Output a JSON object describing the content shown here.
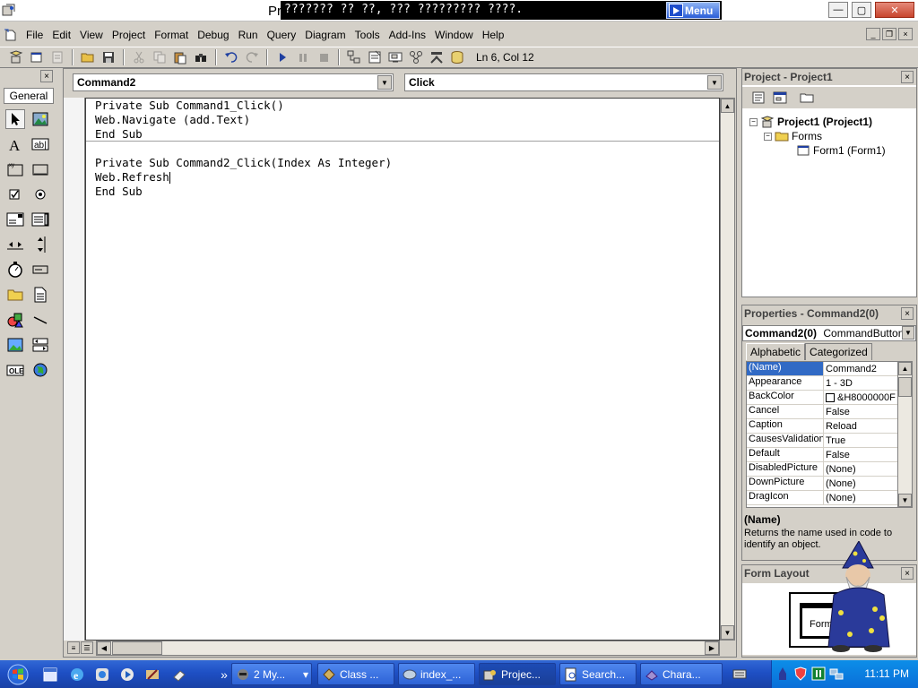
{
  "window": {
    "title_partial": "Pr",
    "overlay_text": "??????? ?? ??, ??? ????????? ????.",
    "overlay_menu_label": "Menu",
    "minimize": "—",
    "maximize": "▢",
    "close": "✕"
  },
  "menubar": {
    "items": [
      "File",
      "Edit",
      "View",
      "Project",
      "Format",
      "Debug",
      "Run",
      "Query",
      "Diagram",
      "Tools",
      "Add-Ins",
      "Window",
      "Help"
    ]
  },
  "toolbar": {
    "cursor_position": "Ln 6, Col 12"
  },
  "toolbox": {
    "tab_label": "General",
    "close": "×"
  },
  "code_window": {
    "object_combo": "Command2",
    "procedure_combo": "Click",
    "lines": [
      "Private Sub Command1_Click()",
      "Web.Navigate (add.Text)",
      "End Sub",
      "Private Sub Command2_Click(Index As Integer)",
      "Web.Refresh",
      "End Sub"
    ]
  },
  "project_explorer": {
    "title": "Project - Project1",
    "close": "×",
    "tree": {
      "root": "Project1 (Project1)",
      "folder": "Forms",
      "form": "Form1 (Form1)"
    }
  },
  "properties": {
    "title": "Properties - Command2(0)",
    "close": "×",
    "object_name": "Command2(0)",
    "object_type": "CommandButton",
    "tabs": [
      "Alphabetic",
      "Categorized"
    ],
    "rows": [
      {
        "name": "(Name)",
        "value": "Command2"
      },
      {
        "name": "Appearance",
        "value": "1 - 3D"
      },
      {
        "name": "BackColor",
        "value": "&H8000000F"
      },
      {
        "name": "Cancel",
        "value": "False"
      },
      {
        "name": "Caption",
        "value": "Reload"
      },
      {
        "name": "CausesValidation",
        "value": "True"
      },
      {
        "name": "Default",
        "value": "False"
      },
      {
        "name": "DisabledPicture",
        "value": "(None)"
      },
      {
        "name": "DownPicture",
        "value": "(None)"
      },
      {
        "name": "DragIcon",
        "value": "(None)"
      }
    ],
    "description_name": "(Name)",
    "description_text": "Returns the name used in code to identify an object."
  },
  "form_layout": {
    "title": "Form Layout",
    "close": "×",
    "form_label": "Form"
  },
  "taskbar": {
    "tasks": [
      {
        "label": "2 My...",
        "active": false
      },
      {
        "label": "Class ...",
        "active": false
      },
      {
        "label": "index_...",
        "active": false
      },
      {
        "label": "Projec...",
        "active": true
      },
      {
        "label": "Search...",
        "active": false
      },
      {
        "label": "Chara...",
        "active": false
      }
    ],
    "more_label": "»",
    "clock": "11:11 PM"
  }
}
